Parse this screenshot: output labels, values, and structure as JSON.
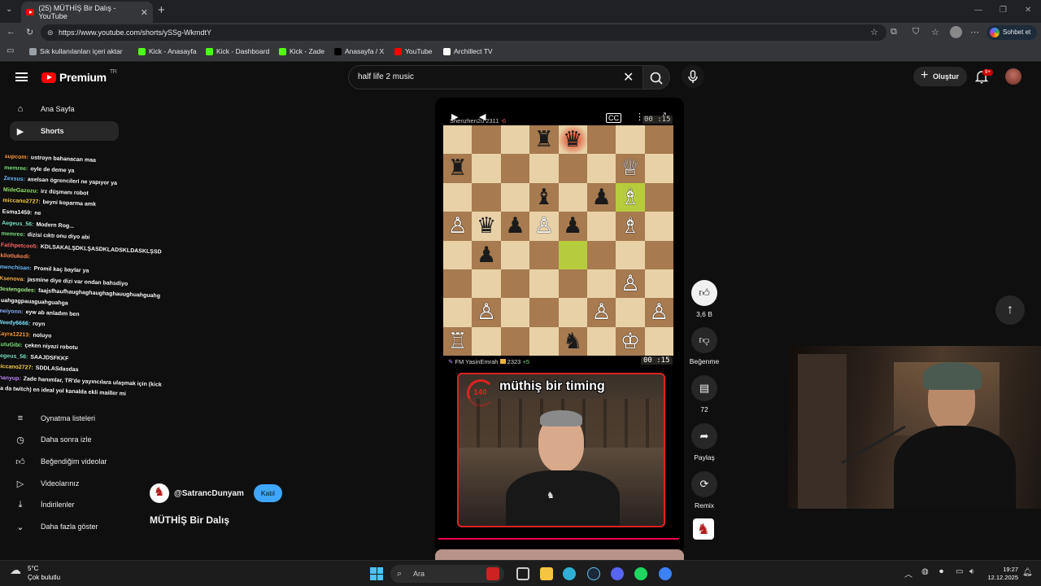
{
  "browser": {
    "tab_title": "(25) MÜTHİŞ Bir Dalış - YouTube",
    "url": "https://www.youtube.com/shorts/ySSg-WkmdtY",
    "copilot_label": "Sohbet et",
    "bookmarks": [
      {
        "label": "Sık kullanılanları içeri aktar",
        "color": "#9aa0a6"
      },
      {
        "label": "Kick - Anasayfa",
        "color": "#53fc18"
      },
      {
        "label": "Kick - Dashboard",
        "color": "#53fc18"
      },
      {
        "label": "Kick - Zade",
        "color": "#53fc18"
      },
      {
        "label": "Anasayfa / X",
        "color": "#000000"
      },
      {
        "label": "YouTube",
        "color": "#ff0000"
      },
      {
        "label": "Archillect TV",
        "color": "#ffffff"
      }
    ]
  },
  "header": {
    "logo_text": "Premium",
    "logo_region": "TR",
    "search_value": "half life 2 music",
    "create_label": "Oluştur",
    "notification_count": "9+"
  },
  "sidebar": {
    "items": [
      {
        "label": "Ana Sayfa",
        "icon": "home-icon"
      },
      {
        "label": "Shorts",
        "icon": "shorts-icon"
      },
      {
        "label": "Oynatma listeleri",
        "icon": "playlist-icon"
      },
      {
        "label": "Daha sonra izle",
        "icon": "clock-icon"
      },
      {
        "label": "Beğendiğim videolar",
        "icon": "thumbs-up-icon"
      },
      {
        "label": "Videolarınız",
        "icon": "video-icon"
      },
      {
        "label": "İndirilenler",
        "icon": "download-icon"
      },
      {
        "label": "Daha fazla göster",
        "icon": "chevron-down-icon"
      }
    ]
  },
  "chat": {
    "lines": [
      {
        "user": "supcom:",
        "text": "ustroyn bahanacan maa",
        "color": "#ff9e3d"
      },
      {
        "user": "memree:",
        "text": "oyle de deme ya",
        "color": "#7de37d"
      },
      {
        "user": "Zexsus:",
        "text": "aselsan ögrencileri ne yapıyor ya",
        "color": "#6fc1ff"
      },
      {
        "user": "MideGazozu:",
        "text": "irz düşmanı robot",
        "color": "#9ae66e"
      },
      {
        "user": "miccano2727:",
        "text": "beyni koparma amk",
        "color": "#ffd24a"
      },
      {
        "user": "Esma1459:",
        "text": "ne",
        "color": "#ffffff"
      },
      {
        "user": "Aegeus_56:",
        "text": "Modern Rog...",
        "color": "#7ee3c8"
      },
      {
        "user": "memree:",
        "text": "dizisi cıktı onu diyo abi",
        "color": "#7de37d"
      },
      {
        "user": "Fatihpetcoo5:",
        "text": "KDLSAKALŞDKLŞASDKLADSKLDASKLŞSD",
        "color": "#ff6a6a"
      },
      {
        "user": "kilotlukedi:",
        "text": "",
        "color": "#ff8a5a"
      },
      {
        "user": "menchisan:",
        "text": "Promil kaç baylar ya",
        "color": "#6fc1ff"
      },
      {
        "user": "Ksenova:",
        "text": "jasmine diye dizi var ondan bahsdiyo",
        "color": "#ffb24a"
      },
      {
        "user": "destengodes:",
        "text": "faajsfhaufhaughaghaughaghauughuahguahg",
        "color": "#a6f08a"
      },
      {
        "user": "",
        "text": "uahgagpauaguahguahga",
        "color": "#ffffff"
      },
      {
        "user": "meiyonn:",
        "text": "eyw ab anladım ben",
        "color": "#8fb4ff"
      },
      {
        "user": "Weedy6666:",
        "text": "royn",
        "color": "#7fe3ff"
      },
      {
        "user": "Kayra12213:",
        "text": "noluyo",
        "color": "#ff9e3d"
      },
      {
        "user": "KutuGibi:",
        "text": "çeken niyazi robotu",
        "color": "#7de37d"
      },
      {
        "user": "Aegeus_56:",
        "text": "SAAJDSFKKF",
        "color": "#7ee3c8"
      },
      {
        "user": "miccano2727:",
        "text": "SDDLASdasdas",
        "color": "#ffd24a"
      },
      {
        "user": "Shanyup:",
        "text": "Zade hanımlar, TR'de yayıncılara ulaşmak için (kick",
        "color": "#c08aff"
      },
      {
        "user": "",
        "text": "ya da twitch) en ideal yol kanalda ekli mailler mi",
        "color": "#ffffff"
      }
    ]
  },
  "short": {
    "top_player": "Shenzhen2u 2311",
    "top_player_diff": "-6",
    "top_clock": "00 :15",
    "bottom_player": "FM YasinEmrah",
    "bottom_rating": "2323",
    "bottom_diff": "+5",
    "bottom_clock": "00 :15",
    "overlay_title": "müthiş bir timing",
    "overlay_counter": "140",
    "channel": "@SatrancDunyam",
    "join_label": "Katıl",
    "title": "MÜTHİŞ Bir Dalış"
  },
  "board": {
    "light": "#e8d1a7",
    "dark": "#a77a4f",
    "highlight": "#b7cc3d",
    "check": "#e05a3a",
    "pieces": [
      {
        "sq": "d8",
        "p": "♜",
        "c": "b"
      },
      {
        "sq": "e8",
        "p": "♛",
        "c": "b"
      },
      {
        "sq": "a7",
        "p": "♜",
        "c": "b"
      },
      {
        "sq": "g7",
        "p": "♕",
        "c": "w"
      },
      {
        "sq": "d6",
        "p": "♝",
        "c": "b"
      },
      {
        "sq": "f6",
        "p": "♟",
        "c": "b"
      },
      {
        "sq": "g6",
        "p": "♗",
        "c": "w"
      },
      {
        "sq": "a5",
        "p": "♙",
        "c": "w"
      },
      {
        "sq": "b5",
        "p": "♛",
        "c": "b"
      },
      {
        "sq": "c5",
        "p": "♟",
        "c": "b"
      },
      {
        "sq": "d5",
        "p": "♙",
        "c": "w"
      },
      {
        "sq": "e5",
        "p": "♟",
        "c": "b"
      },
      {
        "sq": "g5",
        "p": "♗",
        "c": "w"
      },
      {
        "sq": "b4",
        "p": "♟",
        "c": "b"
      },
      {
        "sq": "g3",
        "p": "♙",
        "c": "w"
      },
      {
        "sq": "b2",
        "p": "♙",
        "c": "w"
      },
      {
        "sq": "f2",
        "p": "♙",
        "c": "w"
      },
      {
        "sq": "h2",
        "p": "♙",
        "c": "w"
      },
      {
        "sq": "a1",
        "p": "♖",
        "c": "w"
      },
      {
        "sq": "e1",
        "p": "♞",
        "c": "b"
      },
      {
        "sq": "g1",
        "p": "♔",
        "c": "w"
      }
    ],
    "highlight_squares": [
      "e4",
      "g6"
    ],
    "check_square": "e8"
  },
  "actions": {
    "like_count": "3,6 B",
    "dislike_label": "Beğenme",
    "comments_count": "72",
    "share_label": "Paylaş",
    "remix_label": "Remix"
  },
  "taskbar": {
    "temperature": "5°C",
    "weather": "Çok bulutlu",
    "search_label": "Ara",
    "time": "19:27",
    "date": "12.12.2025"
  }
}
